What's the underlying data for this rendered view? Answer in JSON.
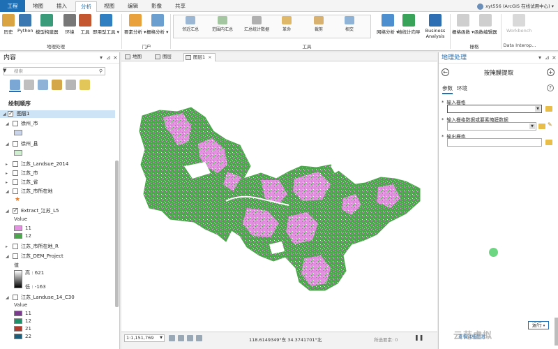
{
  "tabs": {
    "project": "工程",
    "items": [
      "地图",
      "插入",
      "分析",
      "视图",
      "编辑",
      "影像",
      "共享"
    ],
    "active_index": 2
  },
  "user": {
    "name": "xyt556 (ArcGIS 在线试用中心)",
    "notify_icon": "bell-icon"
  },
  "ribbon": {
    "geoprocessing": {
      "label": "地理处理",
      "buttons": [
        "历史",
        "Python",
        "模型构建器",
        "环境",
        "工具",
        "即用型工具"
      ]
    },
    "portal": {
      "label": "门户",
      "buttons": [
        "要素分析",
        "栅格分析"
      ]
    },
    "tools": {
      "label": "工具",
      "gallery": [
        "邻近汇总",
        "范围内汇总",
        "汇总统计数据",
        "革命",
        "裁剪",
        "相交"
      ],
      "buttons": [
        "网络分析",
        "地统计向导",
        "Business Analysis"
      ]
    },
    "raster": {
      "label": "栅格",
      "buttons": [
        "栅格函数",
        "函数编辑器"
      ]
    },
    "interop": {
      "label": "Data Interop...",
      "buttons": [
        "Workbench"
      ]
    }
  },
  "contents": {
    "title": "内容",
    "search_placeholder": "搜索",
    "draw_order": "绘制顺序",
    "layers": {
      "map": "图层1",
      "xuzhou_city": "徐州_市",
      "xuzhou_county": "徐州_县",
      "landsue": "江苏_Landsue_2014",
      "js_city": "江苏_市",
      "js_province": "江苏_省",
      "js_capital": "江苏_市所在地",
      "extract": "Extract_江苏_L5",
      "value_label": "Value",
      "extract_values": [
        "11",
        "12"
      ],
      "js_capital_r": "江苏_市所在地_R",
      "dem": "江苏_DEM_Project",
      "dem_value_label": "值",
      "dem_high": "高 : 621",
      "dem_low": "低 : -163",
      "landuse14": "江苏_Landuse_14_C30",
      "landuse_value_label": "Value",
      "landuse_values": [
        "11",
        "12",
        "21",
        "22"
      ]
    }
  },
  "map": {
    "tabs": [
      "地图",
      "图层",
      "图层1"
    ],
    "active_tab": 2,
    "scale": "1:1,151,769",
    "coords": "118.6149349°东 34.3741701°北",
    "selected": "所选要素: 0",
    "colors": {
      "class11": "#e391e0",
      "class12": "#4ca64c"
    }
  },
  "gp": {
    "title": "地理处理",
    "tool_name": "按掩膜提取",
    "tab_params": "参数",
    "tab_env": "环境",
    "param_input_raster": "输入栅格",
    "param_mask": "输入栅格数据或要素掩膜数据",
    "param_output": "输出栅格",
    "input_value": "",
    "mask_value": "",
    "output_value": "",
    "run_label": "运行",
    "view_details": "查看详细信息"
  },
  "legend_colors": {
    "xuzhou_city": "#c9d4ea",
    "xuzhou_county": "#cfeecf",
    "capital_star": "#e07a2c",
    "extract_11": "#e391e0",
    "extract_12": "#4ca64c",
    "landuse_11": "#7b3b8c",
    "landuse_12": "#1f8f6a",
    "landuse_21": "#b03a2e",
    "landuse_22": "#1c5d7a"
  },
  "watermark": "云范虚拟"
}
